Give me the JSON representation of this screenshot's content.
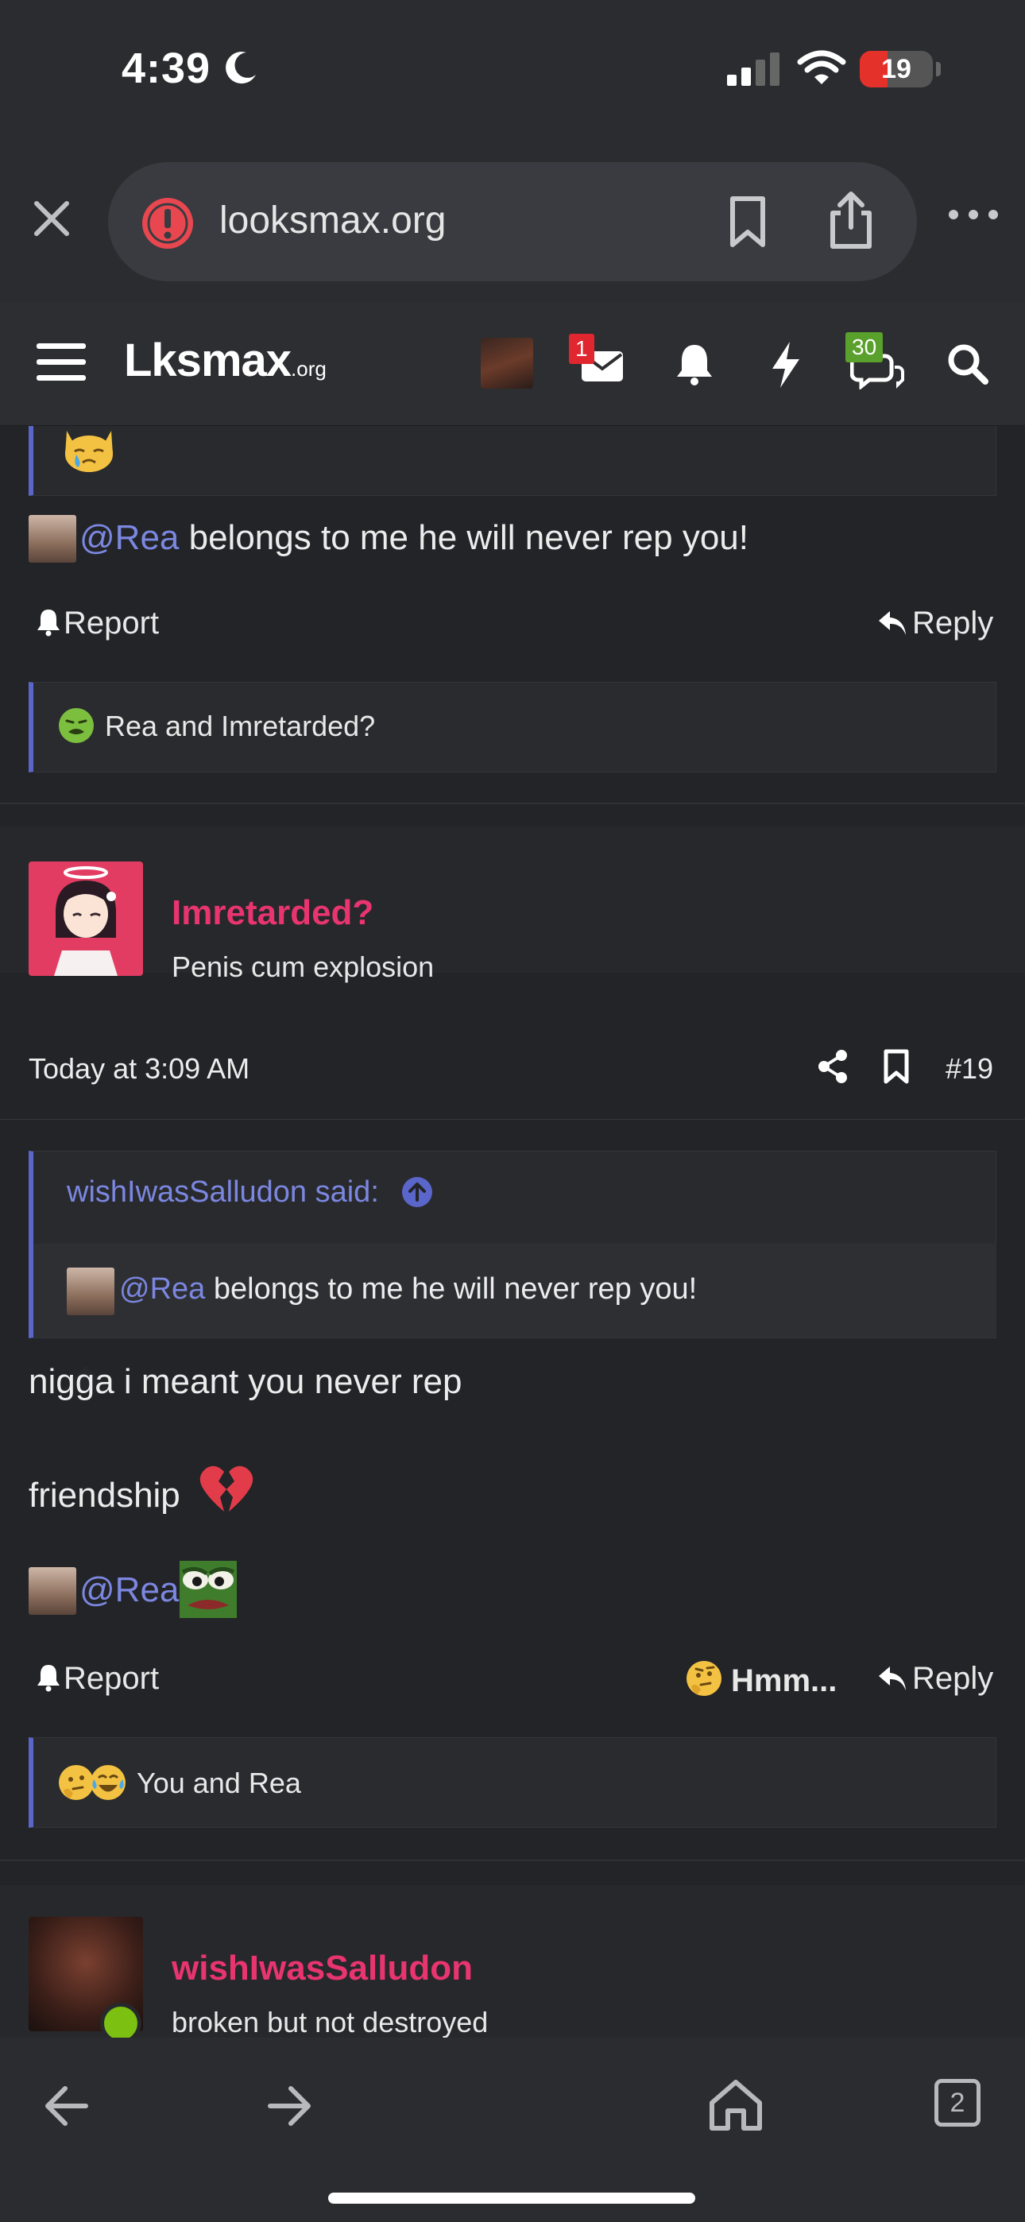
{
  "status_bar": {
    "time": "4:39",
    "battery_level": "19",
    "battery_fraction": 0.19
  },
  "browser": {
    "url": "looksmax.org",
    "tab_count": "2"
  },
  "site_nav": {
    "logo_main": "Lksmax",
    "logo_suffix": ".org",
    "inbox_badge": "1",
    "chat_badge": "30"
  },
  "post_prev": {
    "mention_name": "@Rea",
    "body_text": " belongs to me he will never rep you!",
    "report_label": "Report",
    "reply_label": "Reply",
    "reactions_text": "Rea and Imretarded?"
  },
  "post_19": {
    "username": "Imretarded?",
    "user_title": "Penis cum explosion",
    "timestamp": "Today at 3:09 AM",
    "post_number": "#19",
    "quote": {
      "author_line": "wishIwasSalludon said:",
      "mention_name": "@Rea",
      "text": " belongs to me he will never rep you!"
    },
    "body_line1": "nigga i meant you never rep",
    "body_line2": "friendship",
    "body_mention": "@Rea",
    "report_label": "Report",
    "hmm_label": "Hmm...",
    "reply_label": "Reply",
    "reactions_text": "You and Rea"
  },
  "post_next": {
    "username": "wishIwasSalludon",
    "user_title": "broken but not destroyed"
  },
  "colors": {
    "background": "#232427",
    "username": "#e8346f",
    "mention": "#7b87e0",
    "quote_bar": "#5a66c9",
    "battery_low": "#e4322b",
    "online_dot": "#7cc012"
  }
}
